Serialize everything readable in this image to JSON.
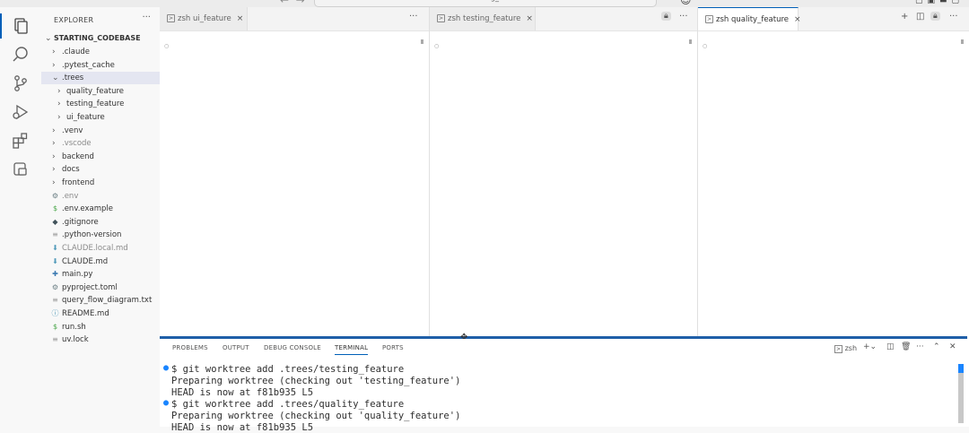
{
  "titlebar": {
    "command_center": "starting_codebase"
  },
  "explorer": {
    "header": "EXPLORER",
    "more": "···",
    "root": "STARTING_CODEBASE",
    "items": [
      {
        "label": ".claude",
        "kind": "folder",
        "depth": 1,
        "dim": false
      },
      {
        "label": ".pytest_cache",
        "kind": "folder",
        "depth": 1,
        "dim": false
      },
      {
        "label": ".trees",
        "kind": "folder-open",
        "depth": 1,
        "dim": false,
        "selected": true
      },
      {
        "label": "quality_feature",
        "kind": "folder",
        "depth": 2,
        "dim": false
      },
      {
        "label": "testing_feature",
        "kind": "folder",
        "depth": 2,
        "dim": false
      },
      {
        "label": "ui_feature",
        "kind": "folder",
        "depth": 2,
        "dim": false
      },
      {
        "label": ".venv",
        "kind": "folder",
        "depth": 1,
        "dim": false
      },
      {
        "label": ".vscode",
        "kind": "folder",
        "depth": 1,
        "dim": true
      },
      {
        "label": "backend",
        "kind": "folder",
        "depth": 1,
        "dim": false
      },
      {
        "label": "docs",
        "kind": "folder",
        "depth": 1,
        "dim": false
      },
      {
        "label": "frontend",
        "kind": "folder",
        "depth": 1,
        "dim": false
      },
      {
        "label": ".env",
        "kind": "file",
        "icon": "⚙",
        "color": "#6d8086",
        "dim": true
      },
      {
        "label": ".env.example",
        "kind": "file",
        "icon": "$",
        "color": "#4aa64a",
        "dim": false
      },
      {
        "label": ".gitignore",
        "kind": "file",
        "icon": "◆",
        "color": "#41535b",
        "dim": false
      },
      {
        "label": ".python-version",
        "kind": "file",
        "icon": "≡",
        "color": "#9a9a9a",
        "dim": false
      },
      {
        "label": "CLAUDE.local.md",
        "kind": "file",
        "icon": "⬇",
        "color": "#519aba",
        "dim": true
      },
      {
        "label": "CLAUDE.md",
        "kind": "file",
        "icon": "⬇",
        "color": "#519aba",
        "dim": false
      },
      {
        "label": "main.py",
        "kind": "file",
        "icon": "✚",
        "color": "#3b79b1",
        "dim": false
      },
      {
        "label": "pyproject.toml",
        "kind": "file",
        "icon": "⚙",
        "color": "#6d8086",
        "dim": false
      },
      {
        "label": "query_flow_diagram.txt",
        "kind": "file",
        "icon": "≡",
        "color": "#9a9a9a",
        "dim": false
      },
      {
        "label": "README.md",
        "kind": "file",
        "icon": "ⓘ",
        "color": "#519aba",
        "dim": false
      },
      {
        "label": "run.sh",
        "kind": "file",
        "icon": "$",
        "color": "#4aa64a",
        "dim": false
      },
      {
        "label": "uv.lock",
        "kind": "file",
        "icon": "≡",
        "color": "#9a9a9a",
        "dim": false
      }
    ]
  },
  "editor": {
    "groups": [
      {
        "tab_icon": "⌨",
        "tab_label": "zsh  ui_feature",
        "close": "×",
        "active": false,
        "more": "···"
      },
      {
        "tab_icon": "⌨",
        "tab_label": "zsh  testing_feature",
        "close": "×",
        "active": false,
        "more": "···"
      },
      {
        "tab_icon": "⌨",
        "tab_label": "zsh  quality_feature",
        "close": "×",
        "active": true,
        "more": "···"
      }
    ],
    "cursor_glyph": "○"
  },
  "panel": {
    "tabs": [
      "PROBLEMS",
      "OUTPUT",
      "DEBUG CONSOLE",
      "TERMINAL",
      "PORTS"
    ],
    "active_tab": "TERMINAL",
    "terminal_name": "zsh",
    "terminal_lines": [
      {
        "text": "$ git worktree add .trees/testing_feature",
        "marker": true
      },
      {
        "text": "Preparing worktree (checking out 'testing_feature')",
        "marker": false
      },
      {
        "text": "HEAD is now at f81b935 L5",
        "marker": false
      },
      {
        "text": "$ git worktree add .trees/quality_feature",
        "marker": true
      },
      {
        "text": "Preparing worktree (checking out 'quality_feature')",
        "marker": false
      },
      {
        "text": "HEAD is now at f81b935 L5",
        "marker": false
      }
    ]
  },
  "colors": {
    "accent": "#005fb8",
    "sash": "#1f5fa8",
    "terminal_marker": "#1a85ff"
  }
}
